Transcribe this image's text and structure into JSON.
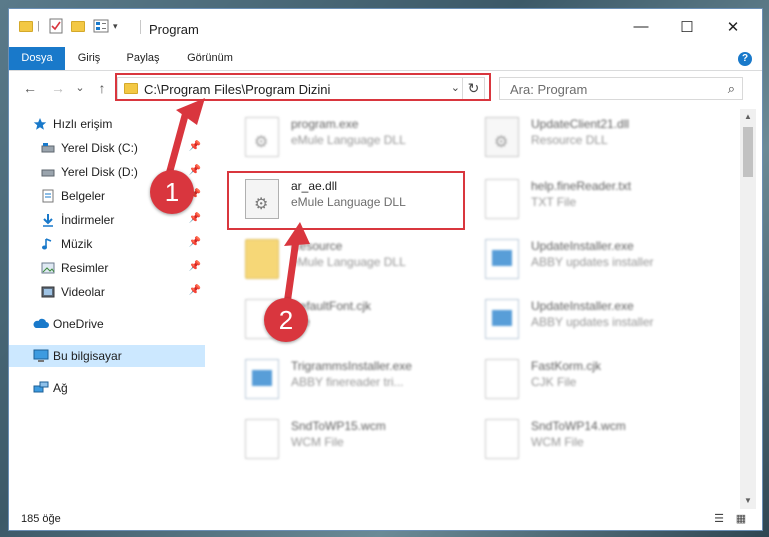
{
  "window": {
    "title": "Program",
    "controls": {
      "minimize": "—",
      "maximize": "☐",
      "close": "✕"
    }
  },
  "ribbon": {
    "tabs": [
      {
        "label": "Dosya",
        "active": true
      },
      {
        "label": "Giriş",
        "active": false
      },
      {
        "label": "Paylaş",
        "active": false
      },
      {
        "label": "Görünüm",
        "active": false
      }
    ],
    "help": "?"
  },
  "nav": {
    "back": "←",
    "forward": "→",
    "recent": "⌄",
    "up": "↑",
    "address": "C:\\Program Files\\Program Dizini",
    "address_chevron": "⌄",
    "refresh": "↻",
    "search_placeholder": "Ara: Program",
    "search_icon": "⌕"
  },
  "sidebar": {
    "items": [
      {
        "label": "Hızlı erişim",
        "icon": "star-icon",
        "pinned": false
      },
      {
        "label": "Yerel Disk (C:)",
        "icon": "drive-icon",
        "pinned": true
      },
      {
        "label": "Yerel Disk (D:)",
        "icon": "drive-icon",
        "pinned": true
      },
      {
        "label": "Belgeler",
        "icon": "documents-icon",
        "pinned": true
      },
      {
        "label": "İndirmeler",
        "icon": "download-icon",
        "pinned": true
      },
      {
        "label": "Müzik",
        "icon": "music-icon",
        "pinned": true
      },
      {
        "label": "Resimler",
        "icon": "pictures-icon",
        "pinned": true
      },
      {
        "label": "Videolar",
        "icon": "video-icon",
        "pinned": true
      },
      {
        "label": "OneDrive",
        "icon": "cloud-icon",
        "pinned": false
      },
      {
        "label": "Bu bilgisayar",
        "icon": "computer-icon",
        "pinned": false,
        "selected": true
      },
      {
        "label": "Ağ",
        "icon": "network-icon",
        "pinned": false
      }
    ],
    "pin_glyph": "📌"
  },
  "files": [
    {
      "name": "program.exe",
      "type": "eMule Language DLL",
      "icon": "program-icon",
      "blurred": true
    },
    {
      "name": "UpdateClient21.dll",
      "type": "Resource DLL",
      "icon": "dll-icon",
      "blurred": true
    },
    {
      "name": "ar_ae.dll",
      "type": "eMule Language DLL",
      "icon": "dll-icon",
      "blurred": false
    },
    {
      "name": "help.fineReader.txt",
      "type": "TXT File",
      "icon": "text-file-icon",
      "blurred": true
    },
    {
      "name": "Resource",
      "type": "eMule Language DLL",
      "icon": "folder-icon",
      "blurred": true
    },
    {
      "name": "UpdateInstaller.exe",
      "type": "ABBY updates installer",
      "icon": "installer-icon",
      "blurred": true
    },
    {
      "name": "DefaultFont.cjk",
      "type": "File",
      "icon": "file-icon",
      "blurred": true
    },
    {
      "name": "UpdateInstaller.exe",
      "type": "ABBY updates installer",
      "icon": "installer-icon",
      "blurred": true
    },
    {
      "name": "TrigrammsInstaller.exe",
      "type": "ABBY finereader tri...",
      "icon": "installer-icon",
      "blurred": true
    },
    {
      "name": "FastKorm.cjk",
      "type": "CJK File",
      "icon": "file-icon",
      "blurred": true
    },
    {
      "name": "SndToWP15.wcm",
      "type": "WCM File",
      "icon": "file-icon",
      "blurred": true
    },
    {
      "name": "SndToWP14.wcm",
      "type": "WCM File",
      "icon": "file-icon",
      "blurred": true
    }
  ],
  "status": {
    "item_count": "185 öğe",
    "details_view": "☰",
    "icons_view": "▦"
  },
  "callouts": {
    "step1": "1",
    "step2": "2",
    "color": "#d9363e"
  },
  "colors": {
    "accent": "#1979ca",
    "selection": "#cce8ff",
    "highlight": "#d9363e"
  }
}
